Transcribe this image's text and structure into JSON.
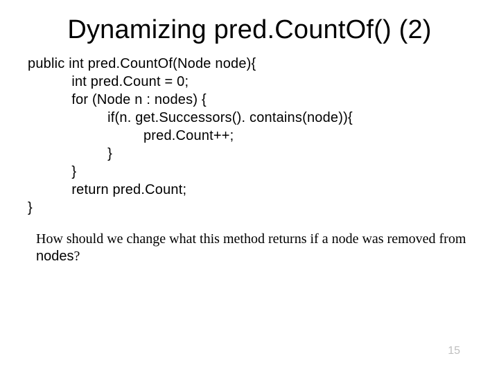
{
  "title": "Dynamizing pred.CountOf() (2)",
  "code": {
    "l1": "public int pred.CountOf(Node node){",
    "l2": "           int pred.Count = 0;",
    "l3": "           for (Node n : nodes) {",
    "l4": "                    if(n. get.Successors(). contains(node)){",
    "l5": "                             pred.Count++;",
    "l6": "                    }",
    "l7": "           }",
    "l8": "           return pred.Count;",
    "l9": "}"
  },
  "question_part1": "How should we change what this method returns if a node was removed from ",
  "question_code": "nodes",
  "question_part2": "?",
  "page_number": "15"
}
